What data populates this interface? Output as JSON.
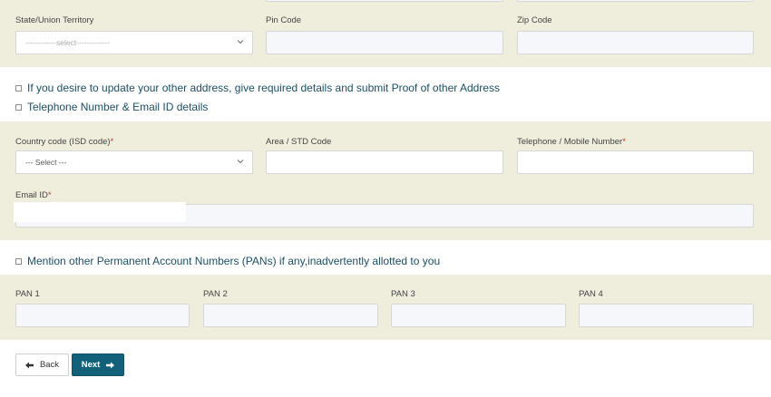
{
  "address_section": {
    "state_label": "State/Union Territory",
    "state_selected": "------------select-------------",
    "pin_label": "Pin Code",
    "pin_value": "",
    "zip_label": "Zip Code",
    "zip_value": ""
  },
  "options": {
    "other_address": "If you desire to update your other address, give required details and submit Proof of other Address",
    "telephone_email": "Telephone Number & Email ID details",
    "other_pans": "Mention other Permanent Account Numbers (PANs) if any,inadvertently allotted to you"
  },
  "contact_section": {
    "country_code_label": "Country code (ISD code)",
    "country_code_selected": "--- Select ---",
    "area_label": "Area / STD Code",
    "area_value": "",
    "telephone_label": "Telephone / Mobile Number",
    "email_label": "Email ID",
    "required_mark": "*"
  },
  "pan_section": {
    "pan1_label": "PAN 1",
    "pan2_label": "PAN 2",
    "pan3_label": "PAN 3",
    "pan4_label": "PAN 4"
  },
  "buttons": {
    "back_label": "Back",
    "next_label": "Next"
  },
  "colors": {
    "panel_bg": "#efeedd",
    "primary_button": "#13607a",
    "option_text": "#1b4f63",
    "required": "#c0392b"
  }
}
